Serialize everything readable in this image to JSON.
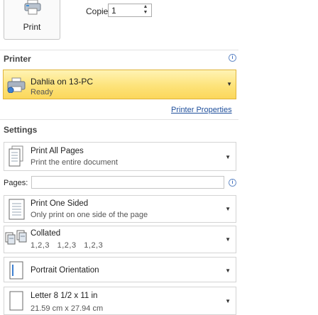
{
  "toolbar": {
    "print_label": "Print",
    "copies_label": "Copies:",
    "copies_value": "1"
  },
  "printer": {
    "section_title": "Printer",
    "name": "Dahlia on 13-PC",
    "status": "Ready",
    "properties_link": "Printer Properties",
    "accent_color": "#fde37a"
  },
  "settings": {
    "section_title": "Settings",
    "pages_label": "Pages:",
    "pages_value": "",
    "items": [
      {
        "title": "Print All Pages",
        "subtitle": "Print the entire document"
      },
      {
        "title": "Print One Sided",
        "subtitle": "Only print on one side of the page"
      },
      {
        "title": "Collated",
        "subtitle": "1,2,3   1,2,3   1,2,3"
      },
      {
        "title": "Portrait Orientation",
        "subtitle": ""
      },
      {
        "title": "Letter 8 1/2 x 11 in",
        "subtitle": "21.59 cm x 27.94 cm"
      }
    ]
  },
  "icons": [
    "printer-icon",
    "info-icon",
    "printer-device-icon",
    "pages-icon",
    "one-sided-icon",
    "collated-icon",
    "portrait-icon",
    "paper-size-icon",
    "dropdown-arrow-icon",
    "spinner-icon"
  ]
}
